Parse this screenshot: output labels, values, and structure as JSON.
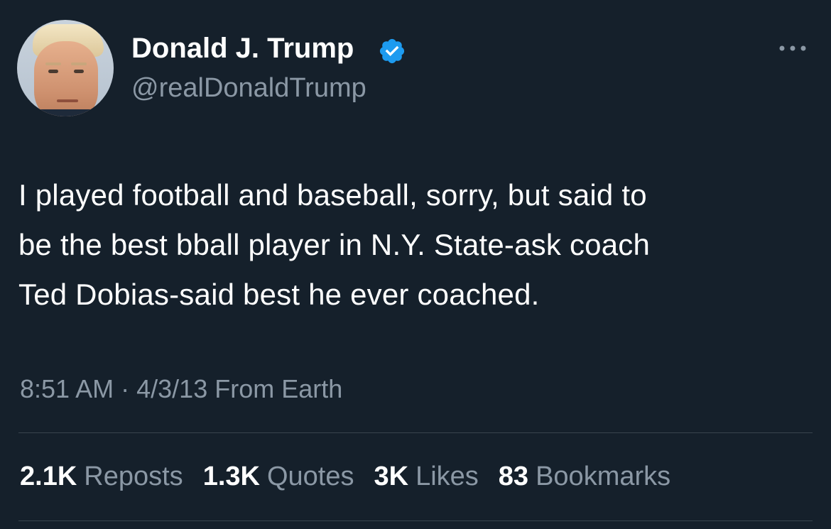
{
  "author": {
    "display_name": "Donald J. Trump",
    "handle": "@realDonaldTrump",
    "verified": true,
    "avatar_icon": "profile-photo"
  },
  "tweet": {
    "lines": [
      "I played football and baseball, sorry, but said to",
      "be the best bball player in N.Y. State-ask coach",
      "Ted Dobias-said best he ever coached."
    ],
    "time": "8:51 AM",
    "separator": "·",
    "date": "4/3/13",
    "source": "From Earth"
  },
  "stats": [
    {
      "count": "2.1K",
      "label": "Reposts"
    },
    {
      "count": "1.3K",
      "label": "Quotes"
    },
    {
      "count": "3K",
      "label": "Likes"
    },
    {
      "count": "83",
      "label": "Bookmarks"
    }
  ],
  "colors": {
    "background": "#15202b",
    "text_primary": "#ffffff",
    "text_secondary": "#8b98a5",
    "verified_badge": "#1d9bf0",
    "divider": "#38444d"
  },
  "icons": {
    "verified": "verified-badge-icon",
    "more": "more-options-icon"
  }
}
